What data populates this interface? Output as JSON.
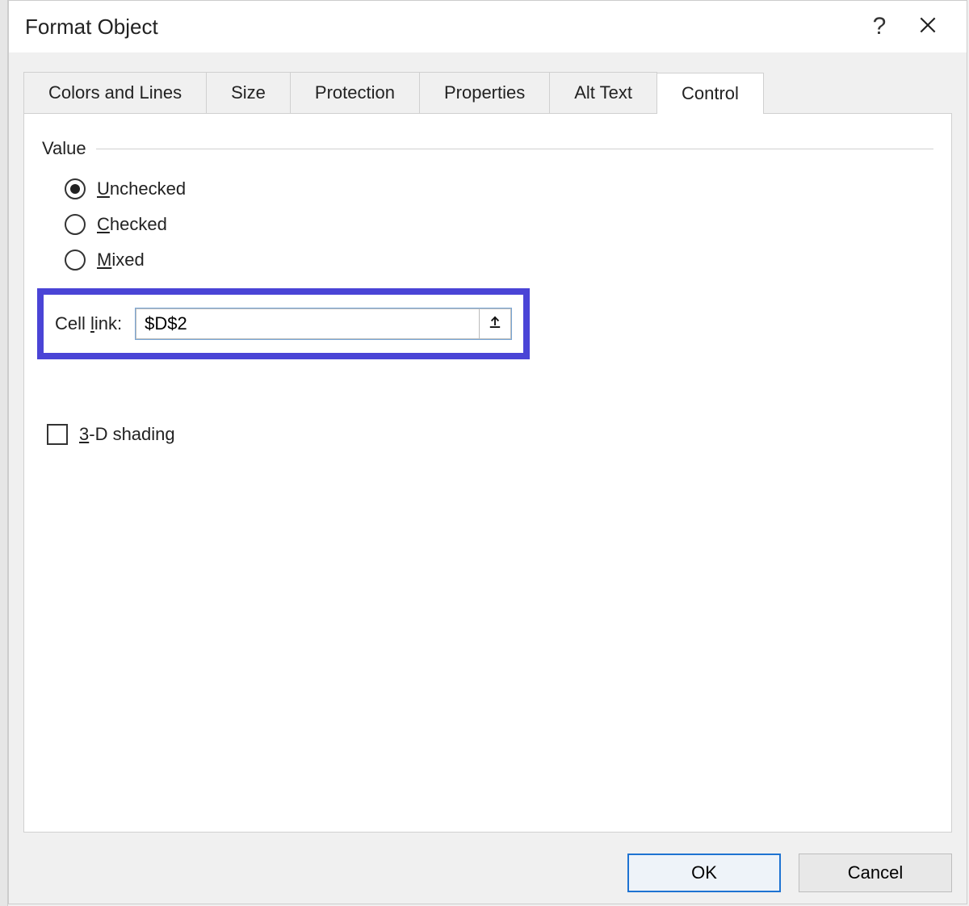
{
  "dialog": {
    "title": "Format Object",
    "help_tooltip": "?",
    "close_tooltip": "Close"
  },
  "tabs": [
    {
      "label": "Colors and Lines",
      "active": false
    },
    {
      "label": "Size",
      "active": false
    },
    {
      "label": "Protection",
      "active": false
    },
    {
      "label": "Properties",
      "active": false
    },
    {
      "label": "Alt Text",
      "active": false
    },
    {
      "label": "Control",
      "active": true
    }
  ],
  "control_tab": {
    "value_group_label": "Value",
    "radios": {
      "unchecked": {
        "prefix": "U",
        "rest": "nchecked",
        "selected": true
      },
      "checked": {
        "prefix": "C",
        "rest": "hecked",
        "selected": false
      },
      "mixed": {
        "prefix": "M",
        "rest": "ixed",
        "selected": false
      }
    },
    "cell_link": {
      "label_prefix": "Cell ",
      "label_ul": "l",
      "label_rest": "ink:",
      "value": "$D$2"
    },
    "shading": {
      "prefix": "3",
      "rest": "-D shading",
      "checked": false
    }
  },
  "buttons": {
    "ok": "OK",
    "cancel": "Cancel"
  }
}
